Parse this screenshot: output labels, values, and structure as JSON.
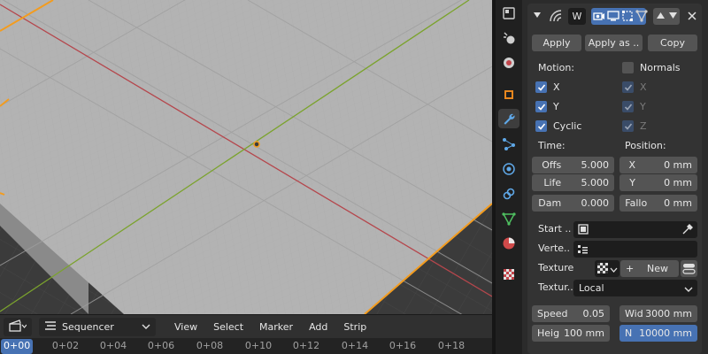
{
  "viewport": {
    "colors": {
      "grid_plane": "#b3b3b3",
      "x_axis": "#b5464c",
      "y_axis": "#7ba32d",
      "selection_outline": "#f39c1f",
      "background": "#3d3d3d"
    }
  },
  "sequencer": {
    "editor_type_icon": "sequencer-clapboard-icon",
    "mode": "Sequencer",
    "menus": [
      "View",
      "Select",
      "Marker",
      "Add",
      "Strip"
    ],
    "current_frame": "0+00",
    "ticks": [
      "0+02",
      "0+04",
      "0+06",
      "0+08",
      "0+10",
      "0+12",
      "0+14",
      "0+16",
      "0+18"
    ]
  },
  "properties_tabs": [
    "tool-icon",
    "render-icon",
    "scene-icon",
    "object-icon",
    "modifier-wrench-icon",
    "particles-icon",
    "physics-icon",
    "constraints-icon",
    "data-mesh-icon",
    "material-icon",
    "texture-icon"
  ],
  "modifier": {
    "name_initial": "W",
    "buttons": {
      "apply": "Apply",
      "apply_as": "Apply as ..",
      "copy": "Copy"
    },
    "motion_label": "Motion:",
    "normals_label": "Normals",
    "motion": {
      "x": "X",
      "y": "Y",
      "cyclic": "Cyclic"
    },
    "normals_axes": {
      "x": "X",
      "y": "Y",
      "z": "Z"
    },
    "time_label": "Time:",
    "position_label": "Position:",
    "time": {
      "offset": {
        "label": "Offs",
        "value": "5.000"
      },
      "life": {
        "label": "Life",
        "value": "5.000"
      },
      "damping": {
        "label": "Dam",
        "value": "0.000"
      }
    },
    "position": {
      "x": {
        "label": "X",
        "value": "0 mm"
      },
      "y": {
        "label": "Y",
        "value": "0 mm"
      },
      "falloff": {
        "label": "Fallo",
        "value": "0 mm"
      }
    },
    "start_label": "Start ..",
    "vertex_label": "Verte..",
    "texture_label": "Texture",
    "texture_new": "New",
    "texture_coords_label": "Textur..",
    "texture_coords_value": "Local",
    "speed": {
      "label": "Speed",
      "value": "0.05"
    },
    "width": {
      "label": "Wid",
      "value": "3000 mm"
    },
    "height": {
      "label": "Heig",
      "value": "100 mm"
    },
    "narrowness": {
      "label": "N",
      "value": "10000 mm"
    },
    "accent_color": "#4772b3"
  }
}
